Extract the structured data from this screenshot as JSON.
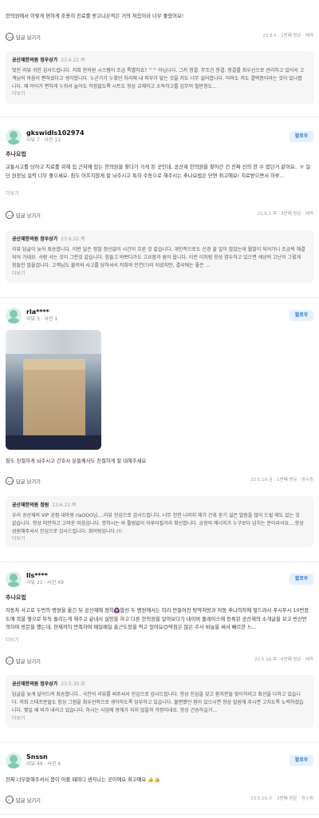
{
  "reviews": [
    {
      "body": "한의원에서 이렇게 편하게 조용히 진료를 받고나온적은 거의 처음이라 너무 좋았어요!",
      "reply_button": "답글 남기기",
      "date_meta": "23.6.5 · 1번째 방문 · 예약",
      "reply": {
        "author": "공산재한의원 정우상가",
        "date": "23.6.22.목",
        "text": "멋진 리뷰 귀한 감사드립니다. 저희 한의원 시스템이 조금 특별하죠? ^^ 아닙니다. 그저 청결. 무조건 청결. 청결를 최우선으로 관리하고 있어서 고객님의 마음이 편하셨다고 생각합니다. 누군가가 누웠던 자리에 내 피부가 닿는 것을 저도 너무 싫어합니다. 아마도 저도 결벽증이라는 것이 있나봅니다. 제 아이가 편하게 누워서 놀아도 걱정없도록 시트도 항상 교체하고 소독하고를 입무의 철반정도...",
        "more": "더보기"
      }
    },
    {
      "name": "gkswidls102974",
      "meta": "리뷰 7 · 사진 12",
      "follow": "팔로우",
      "tag": "추나요법",
      "body": "교통사고를 당하고 치료를 위해 집 근처에 있는 한의원을 찾다가 가게 된 곳인데, 공산재 한의원을 찾아간 건 진짜 신의 한 수 였던거 같아요.. ㅠ 일단 원장님 실력 너무 좋으세요. 침도 아프지않게 잘 놔주시고 특히 수동으로 해주시는 추나요법은 단연 최고에요! 치료받으면서 하루...",
      "more": "더보기",
      "reply_button": "답글 남기기",
      "date_meta": "23.6.1.목 · 3번째 방문 · 예약",
      "reply": {
        "author": "공산재한의원 정우상가",
        "date": "23.6.22.목",
        "text": "리뷰 답글이 늦어 죄송합니다. 이번 달은 정말 정신없이 시간이 흐른 것 같습니다. 개인적으로도 신경 쓸 일이 많았는데 월말이 되어가니 조금씩 해결되어 가네요. 사람 사는 것이 그런것 같습니다. 힘들고 바쁘다가도 고요함과 쉼이 옵니다. 이런 이처럼 항상 염두하고 있으면 세상의 고난이 그렇게 힘들진 않을겁니다. 고객님도 불의의 사고를 당하셔서 저희와 인연(?)이 되셨지만, 결국에는 좋은 ...",
        "more": "더보기"
      }
    },
    {
      "name": "rla****",
      "meta": "리뷰 3 · 사진 1",
      "follow": "팔로우",
      "body": "침도 친절하게 놔주시고 간호사 분들께서도 친절하게 잘 대해주세요",
      "reply_button": "답글 남기기",
      "date_meta": "23.5.19.금 · 1번째 방문 · 영수증",
      "reply": {
        "author": "공산재한의원 정원",
        "date": "23.6.22.목",
        "text": "우리 공산재의 VIP 공점 대마왕 rlaOOO님....리뷰 진심으로 감사드립니다. 너무 친한 나머지 제가 간혹 듣기 싫은 말씀을 많이 드릴 때도 있는 것 같습니다. 항상 미안하고 고마운 마음입니다. 붓하시는 바 틀림없이 이루어질거라 확신합니다. 긍정의 에너지가 누구보다 넘치는 분이라서요....항상 성원해주셔서 진심으로 감사드립니다. 화이팅입니다.!!!",
        "more": "더보기"
      }
    },
    {
      "name": "lls****",
      "meta": "리뷰 21 · 사진 49",
      "follow": "팔로우",
      "tag": "추나요법",
      "body": "자동차 사고로 두번의 병원을 옮긴 뒤 공산재에 정착🙆‍♀️합선 두 병원에서는 미리 만들어진 탕약처방과 자동 추나의자에 엎드려서 푸시푸시 10번정도에 목을 옆으로 뚜둑 돌리는게 해주고 끝내서 실망을 하고 다른 한의원을 알아보다가 네이버 플레이스에 등록된 공산재의 소개글을 보고 반신반의하며 방문을 했는데, 현재까지 만족하며 매일매일 출근도장을 찍고 있어요😊약침은 많은 주사 바늘을 써서 빠르한 느...",
      "more": "더보기",
      "reply_button": "답글 남기기",
      "date_meta": "23.5.18.목 · 6번째 방문 · 예약",
      "reply": {
        "author": "공산재한의원 정우상가",
        "date": "23.5.30.화",
        "text": "답글을 늦게 달아드려 죄송합니다.. 극찬의 리뷰를 써주셔서 진심으로 감사드립니다. 항상 진심을 갖고 환자분들 맞이하려고 최선을 다하고 있습니다. 저희 스태프분들도 항상 그점을 최우선적으로 생각하도록 당부하고 있습니다. 불편했던 점이 있으시면 항상 말씀해 주시면 고치도록 노력하겠습니다. 몇일 째 비가 내리고 있습니다. 하시는 사업에 방해가 되지 않을까 걱정이네요. 항상 건승하실거...",
        "more": "더보기"
      }
    },
    {
      "name": "Snssn",
      "meta": "리뷰 49 · 사진 4",
      "follow": "팔로우",
      "body": "진짜 너무잘해주셔서 몸이 아플 때마다 생각나는 곳이에요 최고예요 👍👍",
      "reply_button": "답글 남기기",
      "date_meta": "23.5.10.수 · 2번째 방문 · 영수증"
    }
  ]
}
